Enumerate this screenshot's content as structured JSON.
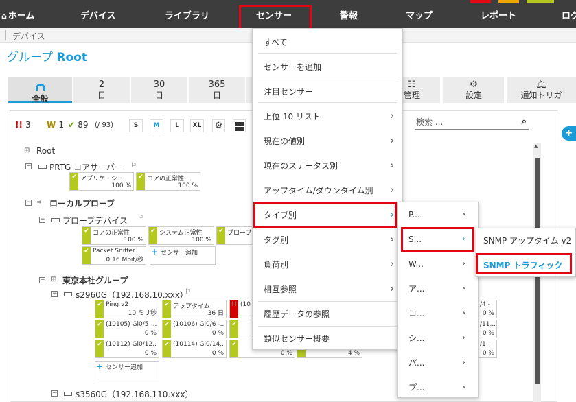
{
  "nav": {
    "items": [
      "ホーム",
      "デバイス",
      "ライブラリ",
      "センサー",
      "警報",
      "マップ",
      "レポート",
      "ログ"
    ]
  },
  "breadcrumb": "デバイス",
  "page_title": {
    "prefix": "グループ",
    "name": "Root"
  },
  "tabs": [
    {
      "line1": "",
      "line2": "全般"
    },
    {
      "line1": "2",
      "line2": "日"
    },
    {
      "line1": "30",
      "line2": "日"
    },
    {
      "line1": "365",
      "line2": "日"
    },
    {
      "line1": "",
      "line2": "管理"
    },
    {
      "line1": "",
      "line2": "設定"
    },
    {
      "line1": "",
      "line2": "通知トリガ"
    }
  ],
  "summary": {
    "errors": "3",
    "warnings": "1",
    "ok": "89",
    "total": "(/ 93)"
  },
  "sizes": [
    "S",
    "M",
    "L",
    "XL"
  ],
  "search": {
    "placeholder": "検索 ..."
  },
  "tree": {
    "root": "Root",
    "core_server": "PRTG コアサーバー",
    "core_tiles": [
      {
        "name": "アプリケーシ...",
        "value": "100 %"
      },
      {
        "name": "コアの正常性...",
        "value": "100 %"
      }
    ],
    "local_probe": "ローカルプローブ",
    "probe_device": "プローブデバイス",
    "probe_tiles": [
      {
        "name": "コアの正常性",
        "value": "100 %"
      },
      {
        "name": "システム正常性",
        "value": "100 %"
      },
      {
        "name": "プローブ",
        "value": ""
      },
      {
        "name": "Packet Sniffer",
        "value": "0.16 Mbit/秒"
      }
    ],
    "add_sensor": "センサー追加",
    "tokyo_group": "東京本社グループ",
    "s2960": "s2960G（192.168.10.xxx）",
    "s2960_tiles": [
      {
        "name": "Ping v2",
        "value": "10 ミリ秒"
      },
      {
        "name": "アップタイム",
        "value": "36 日"
      },
      {
        "name": "(10",
        "value": ""
      },
      {
        "name": "(10105) Gi0/5 -...",
        "value": "0 %"
      },
      {
        "name": "(10106) Gi0/6 -...",
        "value": "0 %"
      },
      {
        "name": "(10112) Gi0/12...",
        "value": "0 %"
      },
      {
        "name": "(10114) Gi0/14...",
        "value": "0 %"
      },
      {
        "name": "/4 -",
        "value": "0 %"
      },
      {
        "name": "/11...",
        "value": "0 %"
      },
      {
        "name": "/1 -",
        "value": "0 %"
      },
      {
        "name": "",
        "value": "0 %"
      },
      {
        "name": "",
        "value": "4 %"
      }
    ],
    "s3560": "s3560G（192.168.110.xxx）"
  },
  "menu": {
    "items": [
      "すべて",
      "センサーを追加",
      "注目センサー",
      "上位 10 リスト",
      "現在の値別",
      "現在のステータス別",
      "アップタイム/ダウンタイム別",
      "タイプ別",
      "タグ別",
      "負荷別",
      "相互参照",
      "履歴データの参照",
      "類似センサー概要"
    ]
  },
  "submenu_type": {
    "items": [
      "P...",
      "S...",
      "W...",
      "ア...",
      "コ...",
      "シ...",
      "パ...",
      "プ..."
    ]
  },
  "submenu_s": {
    "items": [
      "SNMP アップタイム v2",
      "SNMP トラフィック"
    ]
  },
  "colors": {
    "accent": "#1a9ad6",
    "ok": "#b4c81e",
    "error": "#d40000",
    "highlight": "#e30613",
    "nav_bg": "#3d3d3d"
  }
}
